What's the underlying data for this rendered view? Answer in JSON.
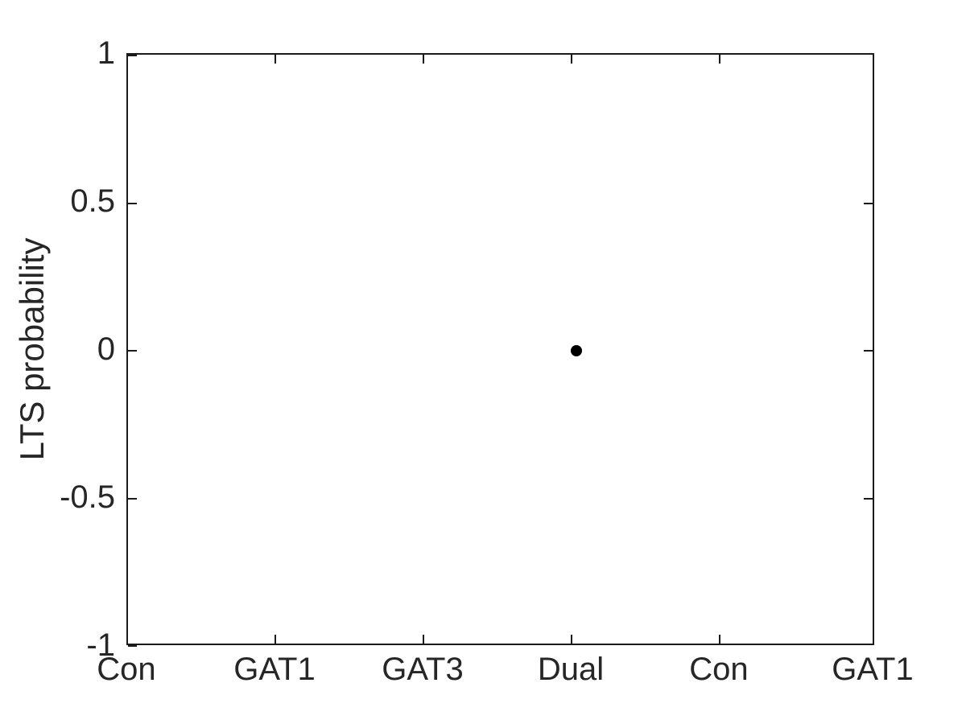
{
  "figure": {
    "background_color": "#ffffff",
    "axis_color": "#1a1a1a",
    "text_color": "#262626",
    "marker_color": "#000000"
  },
  "chart_data": {
    "type": "scatter",
    "title": "",
    "subtitle": "",
    "xlabel": "",
    "ylabel": "LTS probability",
    "categories": [
      "Con",
      "GAT1",
      "GAT3",
      "Dual",
      "Con",
      "GAT1"
    ],
    "x_tick_labels": [
      "Con",
      "GAT1",
      "GAT3",
      "Dual",
      "Con",
      "GAT1"
    ],
    "x_tick_values": [
      1,
      2,
      3,
      4,
      5,
      6
    ],
    "xlim": [
      1,
      6
    ],
    "ylim": [
      -1,
      1
    ],
    "y_tick_values": [
      -1,
      -0.5,
      0,
      0.5,
      1
    ],
    "y_tick_labels": [
      "-1",
      "-0.5",
      "0",
      "0.5",
      "1"
    ],
    "grid": false,
    "legend": null,
    "series": [
      {
        "name": "LTS probability",
        "marker": "filled-circle",
        "marker_color": "#000000",
        "marker_size_px": 14,
        "points": [
          {
            "category": "Dual",
            "x": 4,
            "y": 0
          }
        ]
      }
    ],
    "annotations": []
  }
}
